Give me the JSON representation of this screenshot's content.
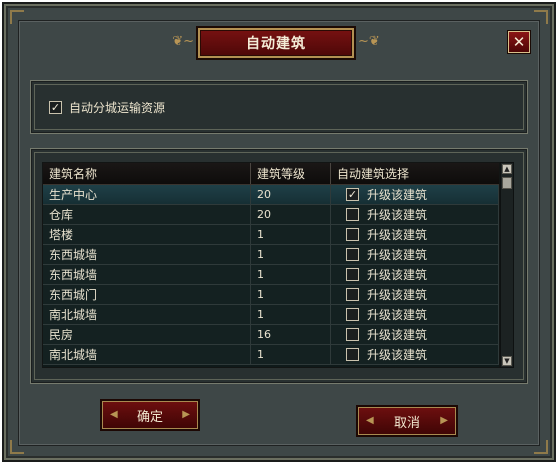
{
  "dialog": {
    "title": "自动建筑",
    "close_label": "✕",
    "title_ornament_left": "❦~",
    "title_ornament_right": "~❦"
  },
  "option": {
    "checked": true,
    "check_glyph": "✓",
    "label": "自动分城运输资源"
  },
  "table": {
    "headers": [
      "建筑名称",
      "建筑等级",
      "自动建筑选择"
    ],
    "rows": [
      {
        "name": "生产中心",
        "level": "20",
        "upgrade_label": "升级该建筑",
        "checked": true,
        "selected": true
      },
      {
        "name": "仓库",
        "level": "20",
        "upgrade_label": "升级该建筑",
        "checked": false,
        "selected": false
      },
      {
        "name": "塔楼",
        "level": "1",
        "upgrade_label": "升级该建筑",
        "checked": false,
        "selected": false
      },
      {
        "name": "东西城墙",
        "level": "1",
        "upgrade_label": "升级该建筑",
        "checked": false,
        "selected": false
      },
      {
        "name": "东西城墙",
        "level": "1",
        "upgrade_label": "升级该建筑",
        "checked": false,
        "selected": false
      },
      {
        "name": "东西城门",
        "level": "1",
        "upgrade_label": "升级该建筑",
        "checked": false,
        "selected": false
      },
      {
        "name": "南北城墙",
        "level": "1",
        "upgrade_label": "升级该建筑",
        "checked": false,
        "selected": false
      },
      {
        "name": "民房",
        "level": "16",
        "upgrade_label": "升级该建筑",
        "checked": false,
        "selected": false
      },
      {
        "name": "南北城墙",
        "level": "1",
        "upgrade_label": "升级该建筑",
        "checked": false,
        "selected": false
      }
    ],
    "check_glyph": "✓"
  },
  "scrollbar": {
    "up_glyph": "▲",
    "down_glyph": "▼"
  },
  "buttons": {
    "ok_label": "确定",
    "cancel_label": "取消",
    "ornament_left": "◀",
    "ornament_right": "▶"
  },
  "colors": {
    "frame": "#3e4747",
    "panel": "#283030",
    "title_red": "#7a1212",
    "gold_trim": "#b39152",
    "selected_row": "#1f4048"
  }
}
